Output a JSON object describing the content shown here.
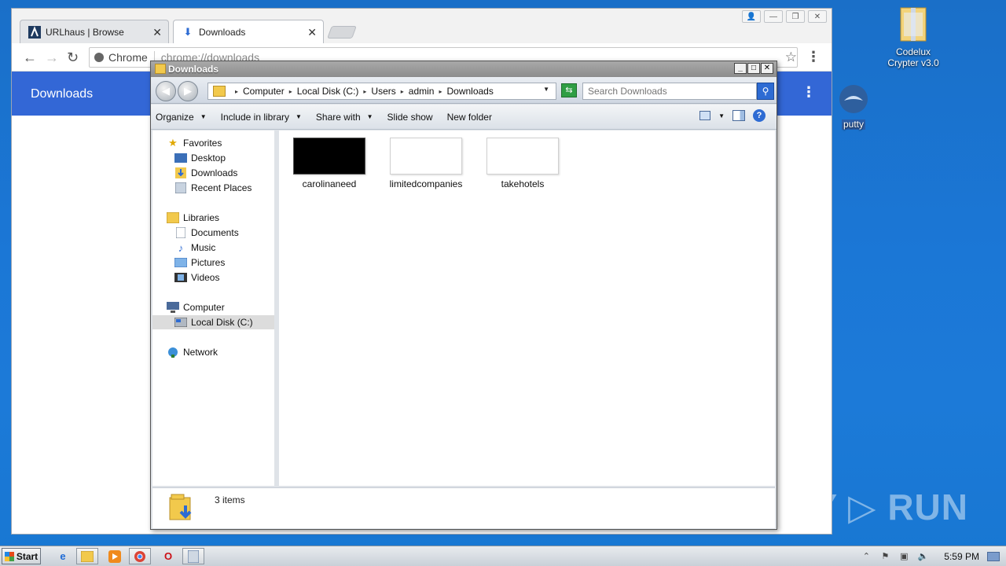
{
  "desktop": {
    "icons": [
      {
        "label_line1": "Codelux",
        "label_line2": "Crypter v3.0"
      },
      {
        "label": "putty"
      }
    ],
    "watermark": "ANY ▷ RUN"
  },
  "browser": {
    "tabs": [
      {
        "title": "URLhaus | Browse",
        "icon": "urlhaus-logo-icon"
      },
      {
        "title": "Downloads",
        "icon": "download-icon"
      }
    ],
    "omnibox": {
      "scheme_label": "Chrome",
      "url": "chrome://downloads"
    },
    "page_title": "Downloads"
  },
  "explorer": {
    "title": "Downloads",
    "breadcrumbs": [
      "Computer",
      "Local Disk (C:)",
      "Users",
      "admin",
      "Downloads"
    ],
    "search_placeholder": "Search Downloads",
    "commands": {
      "organize": "Organize",
      "include_in_library": "Include in library",
      "share_with": "Share with",
      "slide_show": "Slide show",
      "new_folder": "New folder"
    },
    "nav": {
      "favorites": "Favorites",
      "desktop": "Desktop",
      "downloads": "Downloads",
      "recent_places": "Recent Places",
      "libraries": "Libraries",
      "documents": "Documents",
      "music": "Music",
      "pictures": "Pictures",
      "videos": "Videos",
      "computer": "Computer",
      "local_disk": "Local Disk (C:)",
      "network": "Network"
    },
    "files": [
      {
        "name": "carolinaneed",
        "thumb": "dark"
      },
      {
        "name": "limitedcompanies",
        "thumb": "light"
      },
      {
        "name": "takehotels",
        "thumb": "light"
      }
    ],
    "status": "3 items"
  },
  "taskbar": {
    "start_label": "Start",
    "clock": "5:59 PM"
  },
  "colors": {
    "chrome_blue_header": "#3367d6",
    "desktop_blue": "#1b77d6",
    "selection_gray": "#dcdcdc"
  }
}
